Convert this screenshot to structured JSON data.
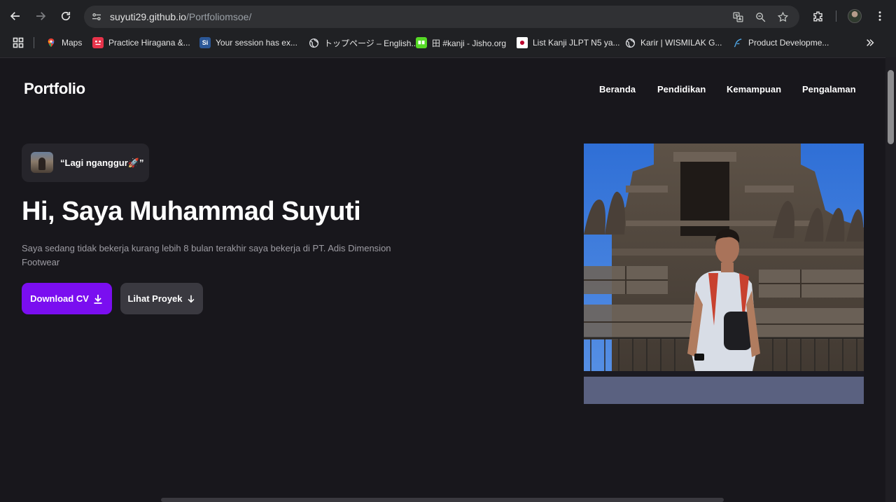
{
  "browser": {
    "url_host": "suyuti29.github.io",
    "url_path": "/Portfoliomsoe/",
    "bookmarks": [
      {
        "label": "Maps",
        "icon": "maps-pin-icon",
        "color": "#34a853"
      },
      {
        "label": "Practice Hiragana &...",
        "icon": "hiragana-icon",
        "color": "#e8334a"
      },
      {
        "label": "Your session has ex...",
        "icon": "si-icon",
        "color": "#2b5797"
      },
      {
        "label": "トップページ – English...",
        "icon": "globe-icon",
        "color": "#9aa0a6"
      },
      {
        "label": "田 #kanji - Jisho.org",
        "icon": "jisho-icon",
        "color": "#56d926"
      },
      {
        "label": "List Kanji JLPT N5 ya...",
        "icon": "japan-flag-icon",
        "color": "#bc002d"
      },
      {
        "label": "Karir | WISMILAK G...",
        "icon": "globe-icon",
        "color": "#9aa0a6"
      },
      {
        "label": "Product Developme...",
        "icon": "feather-icon",
        "color": "#4fa3e0"
      }
    ]
  },
  "site": {
    "brand": "Portfolio",
    "nav": [
      "Beranda",
      "Pendidikan",
      "Kemampuan",
      "Pengalaman"
    ],
    "status_chip": "“Lagi nganggur🚀”",
    "headline": "Hi, Saya Muhammad Suyuti",
    "subtext": "Saya sedang tidak bekerja kurang lebih 8 bulan terakhir saya bekerja di PT. Adis Dimension Footwear",
    "buttons": {
      "download": "Download CV",
      "projects": "Lihat Proyek"
    }
  },
  "colors": {
    "page_bg": "#18171c",
    "primary_button": "#7a0ef0",
    "secondary_button": "#3a3940"
  }
}
